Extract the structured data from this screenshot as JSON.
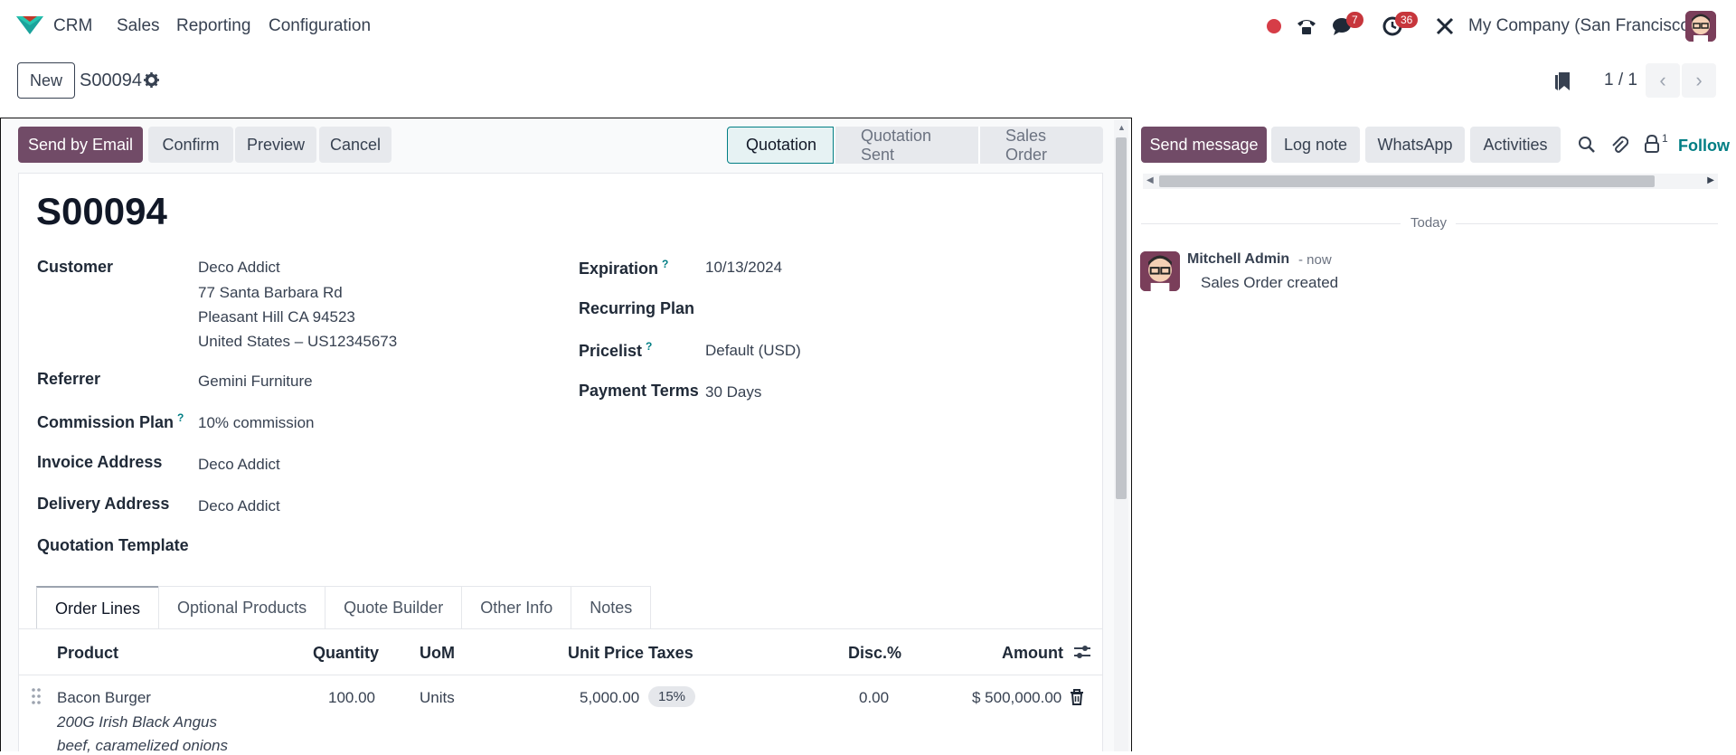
{
  "topnav": {
    "app_name": "CRM",
    "menu": [
      "Sales",
      "Reporting",
      "Configuration"
    ],
    "messages_count": "7",
    "activities_count": "36",
    "company": "My Company (San Francisco)"
  },
  "control_panel": {
    "new_label": "New",
    "record_name": "S00094",
    "pager": "1 / 1"
  },
  "actions": {
    "send_email": "Send by Email",
    "confirm": "Confirm",
    "preview": "Preview",
    "cancel": "Cancel"
  },
  "status": {
    "stages": [
      "Quotation",
      "Quotation Sent",
      "Sales Order"
    ],
    "active": "Quotation"
  },
  "form": {
    "title": "S00094",
    "customer_label": "Customer",
    "customer_name": "Deco Addict",
    "customer_address1": "77 Santa Barbara Rd",
    "customer_address2": "Pleasant Hill CA 94523",
    "customer_address3": "United States – US12345673",
    "referrer_label": "Referrer",
    "referrer": "Gemini Furniture",
    "commission_label": "Commission Plan",
    "commission": "10% commission",
    "invoice_label": "Invoice Address",
    "invoice": "Deco Addict",
    "delivery_label": "Delivery Address",
    "delivery": "Deco Addict",
    "template_label": "Quotation Template",
    "expiration_label": "Expiration",
    "expiration": "10/13/2024",
    "recurring_label": "Recurring Plan",
    "pricelist_label": "Pricelist",
    "pricelist": "Default (USD)",
    "payment_label": "Payment Terms",
    "payment": "30 Days",
    "help_mark": "?"
  },
  "tabs": [
    "Order Lines",
    "Optional Products",
    "Quote Builder",
    "Other Info",
    "Notes"
  ],
  "order_lines": {
    "headers": {
      "product": "Product",
      "quantity": "Quantity",
      "uom": "UoM",
      "unit_price": "Unit Price",
      "taxes": "Taxes",
      "discount": "Disc.%",
      "amount": "Amount"
    },
    "rows": [
      {
        "product": "Bacon Burger",
        "desc1": "200G Irish Black Angus",
        "desc2": "beef, caramelized onions",
        "quantity": "100.00",
        "uom": "Units",
        "unit_price": "5,000.00",
        "taxes": "15%",
        "discount": "0.00",
        "amount": "$ 500,000.00"
      }
    ]
  },
  "chatter": {
    "send_message": "Send message",
    "log_note": "Log note",
    "whatsapp": "WhatsApp",
    "activities": "Activities",
    "followers_count": "1",
    "follow_label": "Follow",
    "date_separator": "Today",
    "messages": [
      {
        "author": "Mitchell Admin",
        "when": "- now",
        "body": "Sales Order created"
      }
    ]
  },
  "colors": {
    "brand": "#714B67",
    "accent": "#017e84",
    "badge": "#c7363c"
  }
}
